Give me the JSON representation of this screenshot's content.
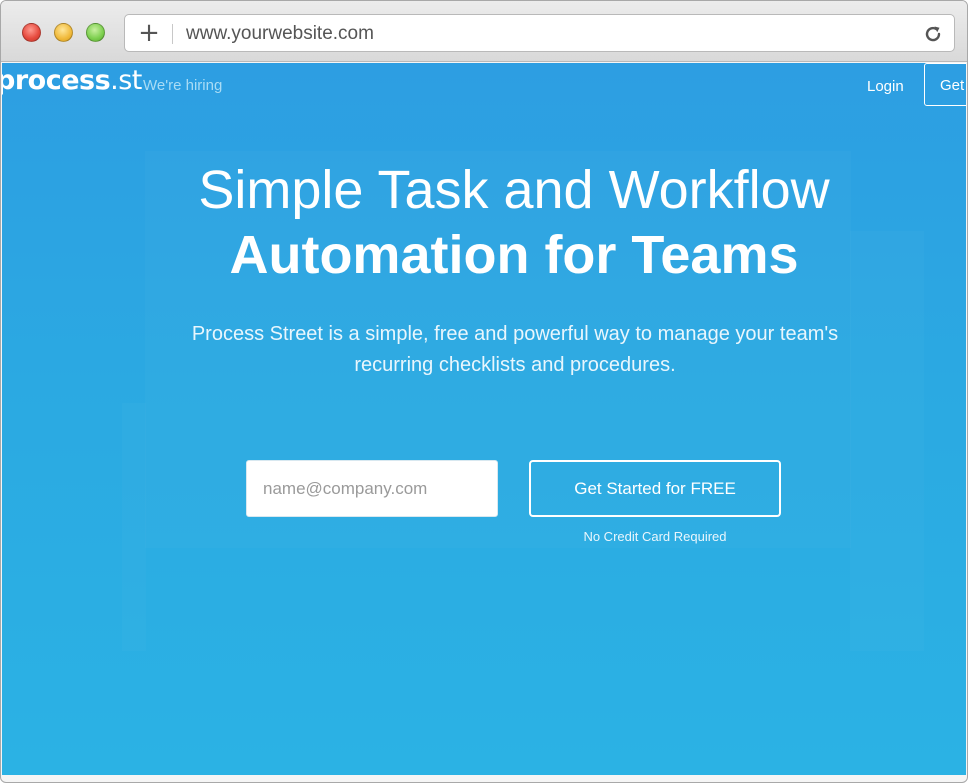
{
  "browser": {
    "url": "www.yourwebsite.com",
    "new_tab_icon": "plus-icon",
    "reload_icon": "reload-icon"
  },
  "nav": {
    "logo_bold": "process",
    "logo_light": ".st",
    "hiring": "We're hiring",
    "login": "Login",
    "get_started_truncated": "Get Started"
  },
  "hero": {
    "headline_line1": "Simple Task and Workflow",
    "headline_line2": "Automation for Teams",
    "subtext": "Process Street is a simple, free and powerful way to manage your team's recurring checklists and procedures.",
    "email_placeholder": "name@company.com",
    "cta_label": "Get Started for FREE",
    "cta_note": "No Credit Card Required"
  },
  "colors": {
    "brand_blue": "#2ba6e2",
    "white": "#ffffff"
  }
}
